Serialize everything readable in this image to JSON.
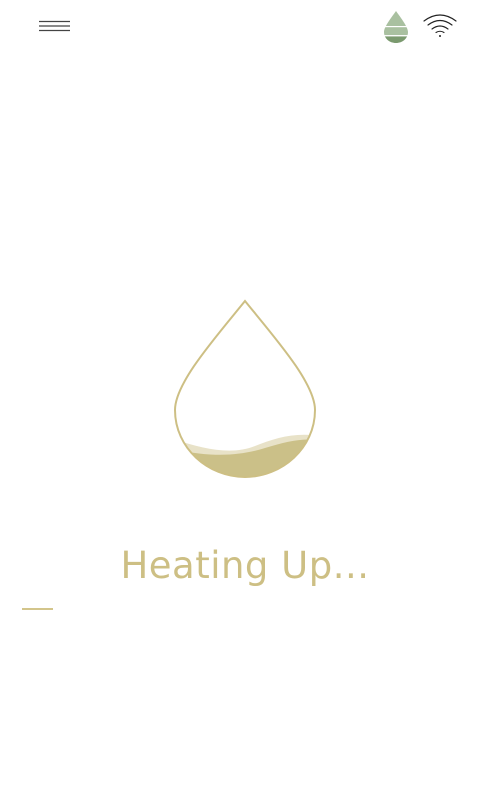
{
  "header": {
    "menu_icon": "hamburger-menu-icon",
    "water_icon": "water-level-icon",
    "wifi_icon": "wifi-icon"
  },
  "main": {
    "status_text": "Heating Up...",
    "illustration": "water-drop-icon"
  },
  "colors": {
    "accent": "#cdbf84",
    "fill_light": "#e8e2c8",
    "fill_dark": "#cbc088",
    "water_icon_light": "#a9c0a0",
    "water_icon_dark": "#7b9a6f",
    "menu_icon": "#444444",
    "wifi_icon": "#222222"
  }
}
